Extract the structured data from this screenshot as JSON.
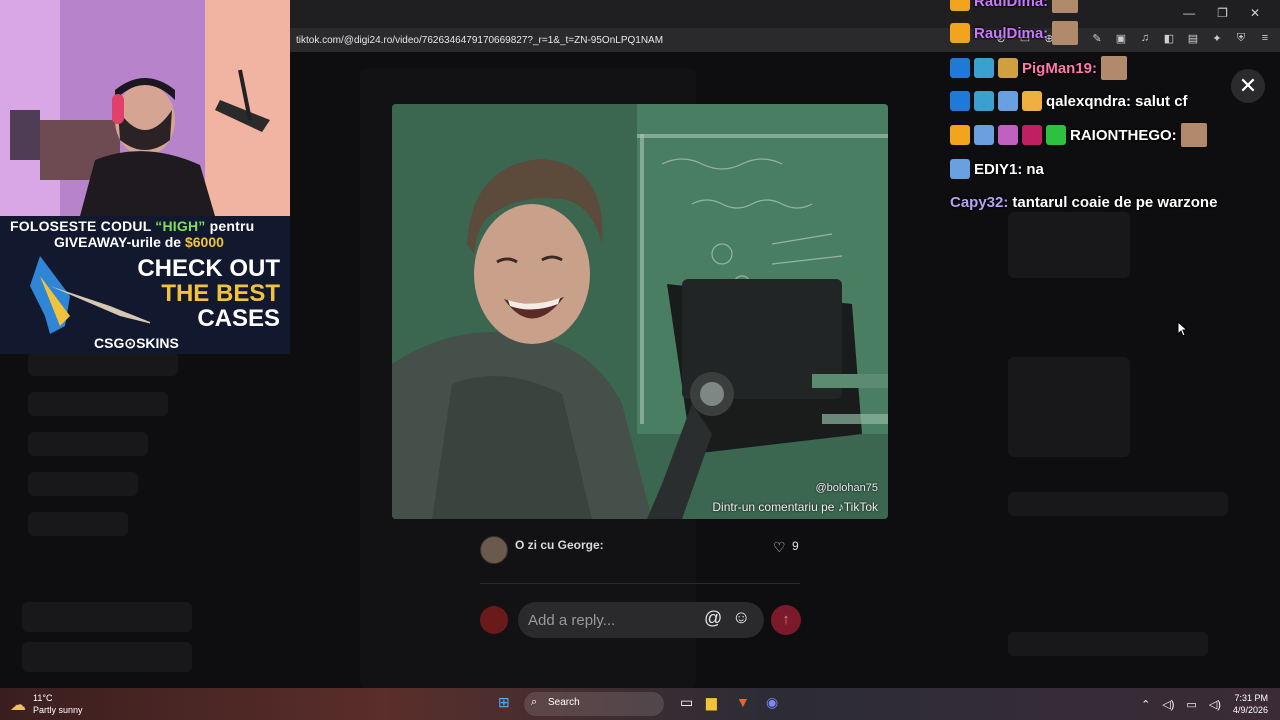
{
  "browser": {
    "url": "tiktok.com/@digi24.ro/video/7626346479170669827?_r=1&_t=ZN-95OnLPQ1NAM",
    "icons": [
      "reader-icon",
      "screenshot-icon",
      "zoom-icon",
      "share-icon"
    ]
  },
  "webcam_promo": {
    "line1_pre": "FOLOSESTE CODUL ",
    "code": "“HIGH”",
    "line1_post": " pentru",
    "line2_pre": "GIVEAWAY-urile de ",
    "amount": "$6000",
    "check": "CHECK OUT",
    "best": "THE BEST",
    "cases": "CASES",
    "brand": "CSG⊙SKINS"
  },
  "chat": {
    "messages": [
      {
        "name": "RaulDima:",
        "text": "",
        "color": "#c87aff",
        "badges": [
          "#f2a41c"
        ],
        "emote": true
      },
      {
        "name": "RaulDima:",
        "text": "",
        "color": "#c87aff",
        "badges": [
          "#f2a41c"
        ],
        "emote": true
      },
      {
        "name": "PigMan19:",
        "text": "",
        "color": "#ff7aa8",
        "badges": [
          "#1e7ad6",
          "#3aa0d0",
          "#d0a040"
        ],
        "emote": true
      },
      {
        "name": "qalexqndra:",
        "text": "salut cf",
        "color": "#ffffff",
        "badges": [
          "#1e7ad6",
          "#3aa0d0",
          "#6aa0e0",
          "#f0b040"
        ],
        "emote": false
      },
      {
        "name": "RAIONTHEGO:",
        "text": "",
        "color": "#ffffff",
        "badges": [
          "#f2a41c",
          "#6aa0e0",
          "#c060c0",
          "#c02060",
          "#30c040"
        ],
        "emote": true
      },
      {
        "name": "EDIY1:",
        "text": "na",
        "color": "#ffffff",
        "badges": [
          "#6aa0e0"
        ],
        "emote": false
      },
      {
        "name": "Capy32:",
        "text": "tantarul coaie de pe warzone",
        "color": "#b9a0f0",
        "badges": [],
        "emote": false
      }
    ]
  },
  "modal": {
    "close_label": "✕",
    "video_watermark_user": "@bolohan75",
    "video_watermark_caption": "Dintr-un comentariu pe ♪TikTok",
    "comment_author": "O zi cu George:",
    "like_count": "9",
    "reply_placeholder": "Add a reply...",
    "at_symbol": "@",
    "send_symbol": "↑"
  },
  "taskbar": {
    "temperature": "11°C",
    "weather": "Partly sunny",
    "search_label": "Search",
    "time": "7:31 PM",
    "date": "4/9/2026"
  }
}
